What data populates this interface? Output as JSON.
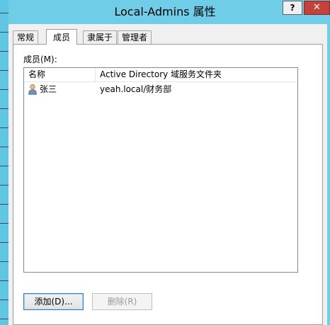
{
  "window": {
    "title": "Local-Admins 属性",
    "help_label": "?",
    "close_label": "✕"
  },
  "tabs": [
    {
      "label": "常规"
    },
    {
      "label": "成员"
    },
    {
      "label": "隶属于"
    },
    {
      "label": "管理者"
    }
  ],
  "active_tab": "成员",
  "members_label": "成员(M):",
  "list": {
    "columns": [
      "名称",
      "Active Directory 域服务文件夹"
    ],
    "rows": [
      {
        "name": "张三",
        "folder": "yeah.local/财务部",
        "icon": "user-icon"
      }
    ]
  },
  "buttons": {
    "add_label": "添加(D)...",
    "remove_label": "删除(R)"
  },
  "colors": {
    "title_bar": "#6fcde8",
    "close_button": "#c4423b"
  }
}
